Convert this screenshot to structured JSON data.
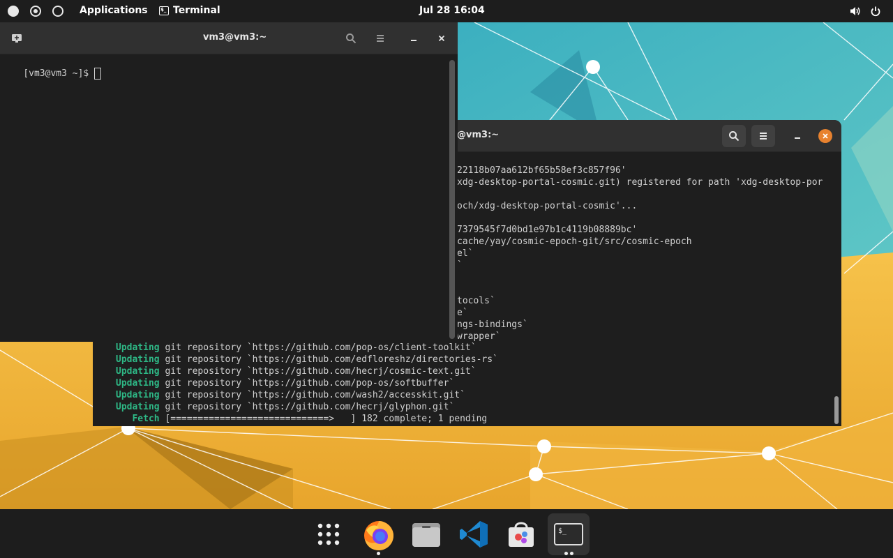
{
  "topbar": {
    "applications_label": "Applications",
    "app_menu_label": "Terminal",
    "clock": "Jul 28  16:04"
  },
  "front_terminal": {
    "title": "vm3@vm3:~",
    "prompt": "[vm3@vm3 ~]$ "
  },
  "back_terminal": {
    "title": "@vm3:~",
    "lines": [
      "22118b07aa612bf65b58ef3c857f96'",
      "xdg-desktop-portal-cosmic.git) registered for path 'xdg-desktop-por",
      "",
      "och/xdg-desktop-portal-cosmic'...",
      "",
      "7379545f7d0bd1e97b1c4119b08889bc'",
      "cache/yay/cosmic-epoch-git/src/cosmic-epoch",
      "el`",
      "`",
      "",
      "",
      "tocols`",
      "e`",
      "ngs-bindings`",
      "wrapper`"
    ],
    "updates": [
      {
        "status": "Updating",
        "text": " git repository `https://github.com/pop-os/client-toolkit`"
      },
      {
        "status": "Updating",
        "text": " git repository `https://github.com/edfloreshz/directories-rs`"
      },
      {
        "status": "Updating",
        "text": " git repository `https://github.com/hecrj/cosmic-text.git`"
      },
      {
        "status": "Updating",
        "text": " git repository `https://github.com/pop-os/softbuffer`"
      },
      {
        "status": "Updating",
        "text": " git repository `https://github.com/wash2/accesskit.git`"
      },
      {
        "status": "Updating",
        "text": " git repository `https://github.com/hecrj/glyphon.git`"
      }
    ],
    "fetch": {
      "status": "   Fetch",
      "text": " [=============================>   ] 182 complete; 1 pending"
    }
  },
  "dock": {
    "items": [
      "app-grid",
      "firefox",
      "files",
      "vscode",
      "software-store",
      "terminal"
    ]
  },
  "colors": {
    "accent_close": "#e8822f",
    "cargo_green": "#2eb886",
    "wall_teal": "#3fb8c9",
    "wall_yellow": "#f0b43a"
  }
}
